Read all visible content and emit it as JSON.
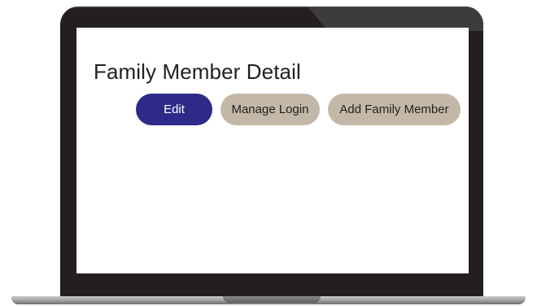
{
  "page": {
    "title": "Family Member Detail"
  },
  "actions": {
    "edit_label": "Edit",
    "manage_login_label": "Manage Login",
    "add_family_member_label": "Add Family Member"
  },
  "colors": {
    "primary_button": "#2e2a8a",
    "secondary_button": "#c3b8a8",
    "bezel": "#231f20"
  }
}
